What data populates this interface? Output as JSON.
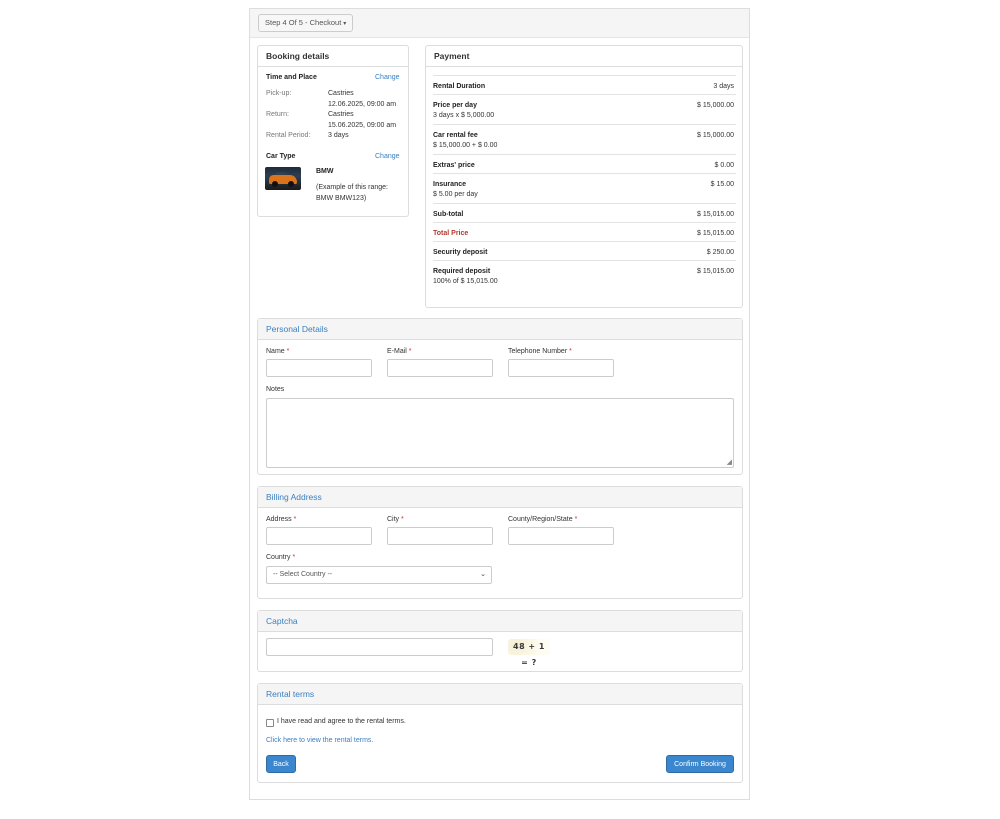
{
  "step_button": "Step 4 Of 5 - Checkout",
  "booking": {
    "title": "Booking details",
    "time_place_title": "Time and Place",
    "change_label": "Change",
    "pickup_label": "Pick-up:",
    "pickup_location": "Castries",
    "pickup_datetime": "12.06.2025, 09:00 am",
    "return_label": "Return:",
    "return_location": "Castries",
    "return_datetime": "15.06.2025, 09:00 am",
    "period_label": "Rental Period:",
    "period_value": "3 days",
    "car_type_title": "Car Type",
    "car_name": "BMW",
    "car_example_line1": "(Example of this range:",
    "car_example_line2": "BMW BMW123)"
  },
  "payment": {
    "title": "Payment",
    "rows": [
      {
        "label": "Rental Duration",
        "sub": "",
        "amount": "3 days"
      },
      {
        "label": "Price per day",
        "sub": "3 days x $ 5,000.00",
        "amount": "$ 15,000.00"
      },
      {
        "label": "Car rental fee",
        "sub": "$ 15,000.00 + $ 0.00",
        "amount": "$ 15,000.00"
      },
      {
        "label": "Extras' price",
        "sub": "",
        "amount": "$ 0.00"
      },
      {
        "label": "Insurance",
        "sub": "$ 5.00 per day",
        "amount": "$ 15.00"
      },
      {
        "label": "Sub-total",
        "sub": "",
        "amount": "$ 15,015.00"
      },
      {
        "label": "Total Price",
        "sub": "",
        "amount": "$ 15,015.00"
      },
      {
        "label": "Security deposit",
        "sub": "",
        "amount": "$ 250.00"
      },
      {
        "label": "Required deposit",
        "sub": "100% of $ 15,015.00",
        "amount": "$ 15,015.00"
      }
    ]
  },
  "personal": {
    "title": "Personal Details",
    "name_label": "Name",
    "email_label": "E-Mail",
    "phone_label": "Telephone Number",
    "notes_label": "Notes",
    "required_mark": "*"
  },
  "billing": {
    "title": "Billing Address",
    "address_label": "Address",
    "city_label": "City",
    "county_label": "County/Region/State",
    "country_label": "Country",
    "country_selected": "-- Select Country --"
  },
  "captcha": {
    "title": "Captcha",
    "challenge": "48 + 1 = ?"
  },
  "terms": {
    "title": "Rental terms",
    "agree_text": "I have read and agree to the rental terms.",
    "view_link": "Click here to view the rental terms.",
    "back_button": "Back",
    "confirm_button": "Confirm Booking"
  },
  "colors": {
    "link": "#3a7fc1",
    "primary_button": "#3a87cf",
    "total_price": "#b03a2e",
    "required": "#c9302c"
  }
}
